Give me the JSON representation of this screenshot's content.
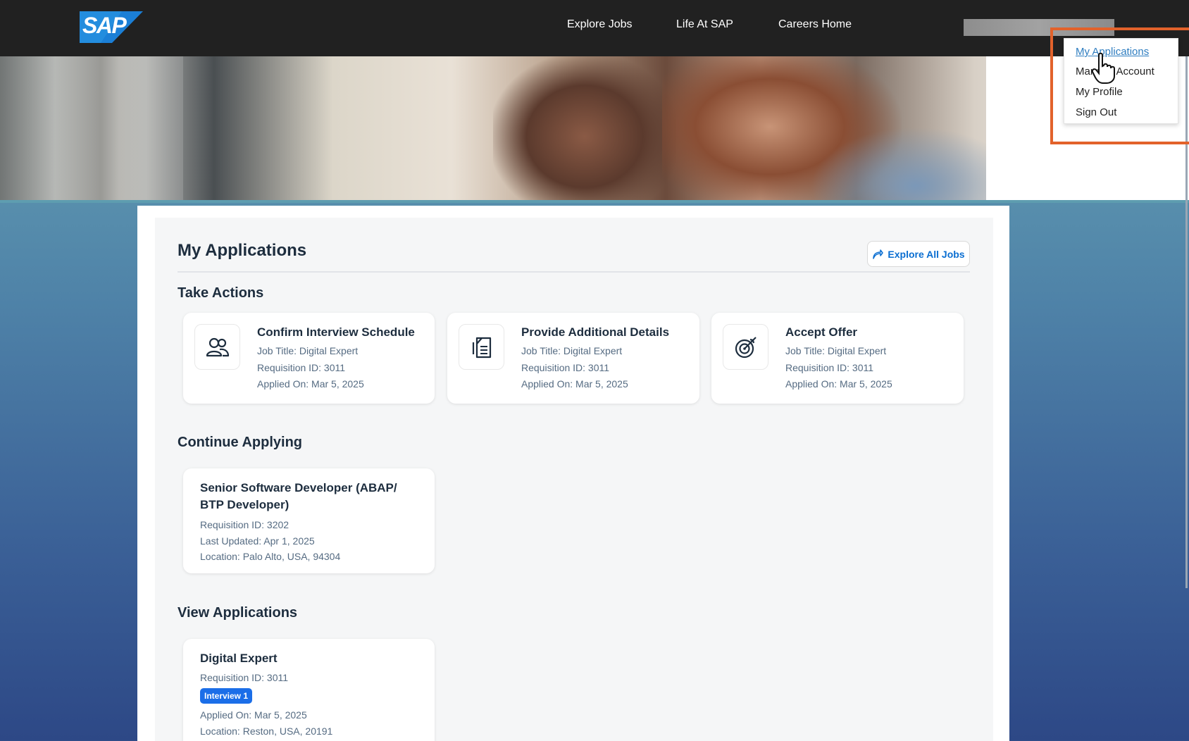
{
  "header": {
    "logo": "SAP",
    "nav": [
      "Explore Jobs",
      "Life At SAP",
      "Careers Home"
    ]
  },
  "user_menu": {
    "items": [
      {
        "label": "My Applications",
        "active": true
      },
      {
        "label": "Manage Account",
        "active": false
      },
      {
        "label": "My Profile",
        "active": false
      },
      {
        "label": "Sign Out",
        "active": false
      }
    ]
  },
  "main": {
    "title": "My Applications",
    "explore_button": "Explore All Jobs",
    "take_actions": {
      "title": "Take Actions",
      "cards": [
        {
          "icon": "people-icon",
          "title": "Confirm Interview Schedule",
          "job": "Job Title: Digital Expert",
          "req": "Requisition ID: 3011",
          "applied": "Applied On: Mar 5, 2025"
        },
        {
          "icon": "document-icon",
          "title": "Provide Additional Details",
          "job": "Job Title: Digital Expert",
          "req": "Requisition ID: 3011",
          "applied": "Applied On: Mar 5, 2025"
        },
        {
          "icon": "target-icon",
          "title": "Accept Offer",
          "job": "Job Title: Digital Expert",
          "req": "Requisition ID: 3011",
          "applied": "Applied On: Mar 5, 2025"
        }
      ]
    },
    "continue_applying": {
      "title": "Continue Applying",
      "card": {
        "title": "Senior Software Developer (ABAP/ BTP Developer)",
        "req": "Requisition ID: 3202",
        "updated": "Last Updated: Apr 1, 2025",
        "location": "Location: Palo Alto, USA, 94304"
      }
    },
    "view_applications": {
      "title": "View Applications",
      "card": {
        "title": "Digital Expert",
        "req": "Requisition ID: 3011",
        "badge": "Interview 1",
        "applied": "Applied On: Mar 5, 2025",
        "location": "Location: Reston, USA, 20191"
      }
    }
  },
  "colors": {
    "highlight": "#e2622b",
    "link": "#0a6ed1",
    "badge": "#1b6ee8"
  }
}
